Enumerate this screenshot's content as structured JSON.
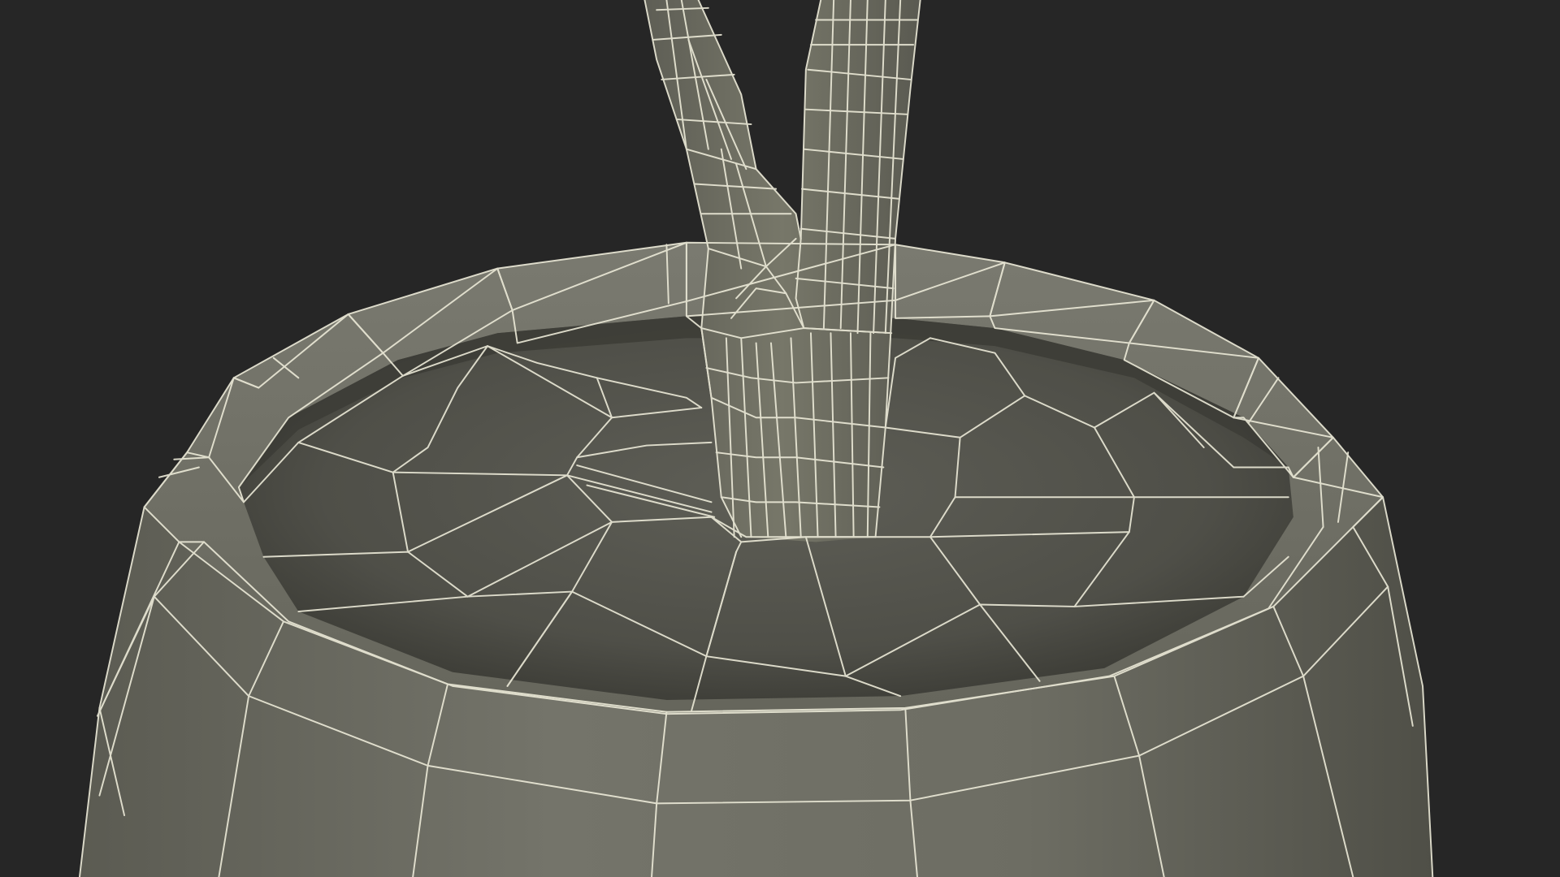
{
  "scene": {
    "background_color": "#262626",
    "mesh_color": "#6e6e63",
    "wire_color": "#ecead8",
    "subject": "wireframe-planter-with-trunk"
  }
}
